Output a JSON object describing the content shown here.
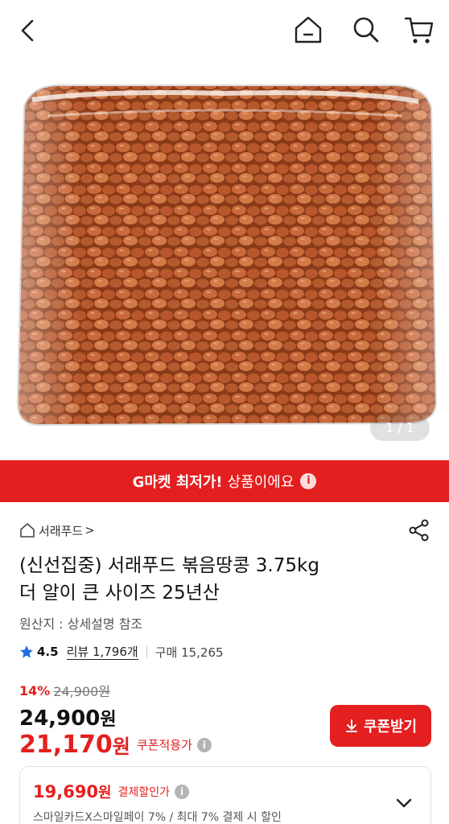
{
  "header": {
    "back_icon": "chevron-left-icon",
    "home_icon": "home-icon",
    "search_icon": "search-icon",
    "cart_icon": "cart-icon"
  },
  "gallery": {
    "counter": "1 / 1"
  },
  "banner": {
    "strong": "G마켓 최저가!",
    "text": "상품이에요",
    "info": "i",
    "color": "#e41f1f"
  },
  "seller": {
    "name": "서래푸드",
    "arrow": ">"
  },
  "product": {
    "title_line1": "(신선집중) 서래푸드 볶음땅콩 3.75kg",
    "title_line2": "더 알이 큰 사이즈 25년산",
    "origin": "원산지 : 상세설명 참조"
  },
  "rating": {
    "score": "4.5",
    "review_text": "리뷰 1,796개",
    "purchase_text": "구매 15,265"
  },
  "price": {
    "discount_pct": "14%",
    "original": "24,900원",
    "current_num": "24,900",
    "current_unit": "원",
    "coupon_num": "21,170",
    "coupon_unit": "원",
    "coupon_label": "쿠폰적용가",
    "info": "i"
  },
  "coupon_button": {
    "label": "쿠폰받기"
  },
  "payment": {
    "num": "19,690",
    "unit": "원",
    "label": "결제할인가",
    "info": "i",
    "detail": "스마일카드X스마일페이 7% / 최대 7% 결제 시 할인"
  }
}
